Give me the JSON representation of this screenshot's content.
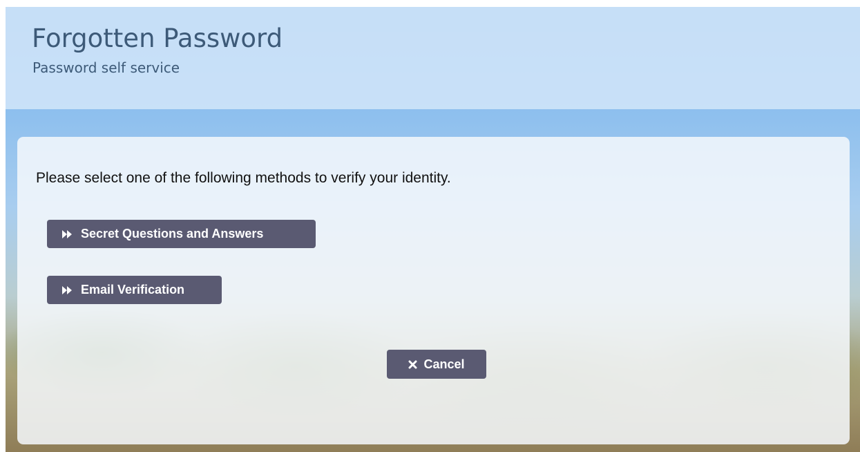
{
  "header": {
    "title": "Forgotten Password",
    "subtitle": "Password self service"
  },
  "main": {
    "instruction": "Please select one of the following methods to verify your identity.",
    "methods": [
      {
        "label": "Secret Questions and Answers",
        "icon": "fast-forward-icon"
      },
      {
        "label": "Email Verification",
        "icon": "fast-forward-icon"
      }
    ],
    "cancel": {
      "label": "Cancel",
      "icon": "close-icon"
    }
  },
  "colors": {
    "header_text": "#3d5a78",
    "button_bg": "#5a5a72",
    "button_text": "#ffffff"
  }
}
